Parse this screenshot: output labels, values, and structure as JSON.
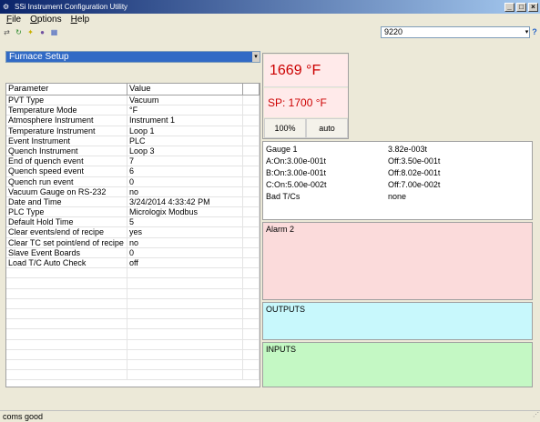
{
  "window": {
    "title": "SSi Instrument Configuration Utility",
    "minimize": "_",
    "maximize": "□",
    "close": "×"
  },
  "menu": [
    "File",
    "Options",
    "Help"
  ],
  "toolbar": {
    "address_value": "9220",
    "dropdown_arrow": "▾",
    "help_symbol": "?"
  },
  "section": {
    "selected": "Furnace Setup",
    "arrow": "▾"
  },
  "grid": {
    "headers": [
      "Parameter",
      "Value"
    ],
    "rows": [
      [
        "PVT Type",
        "Vacuum"
      ],
      [
        "Temperature Mode",
        "°F"
      ],
      [
        "Atmosphere Instrument",
        "Instrument 1"
      ],
      [
        "Temperature Instrument",
        "Loop 1"
      ],
      [
        "Event Instrument",
        "PLC"
      ],
      [
        "Quench Instrument",
        "Loop 3"
      ],
      [
        "End of quench event",
        "7"
      ],
      [
        "Quench speed event",
        "6"
      ],
      [
        "Quench run event",
        "0"
      ],
      [
        "Vacuum Gauge on RS-232",
        "no"
      ],
      [
        "Date and Time",
        "3/24/2014 4:33:42 PM"
      ],
      [
        "PLC Type",
        "Micrologix Modbus"
      ],
      [
        "Default Hold Time",
        "5"
      ],
      [
        "Clear events/end of recipe",
        "yes"
      ],
      [
        "Clear TC set point/end of recipe",
        "no"
      ],
      [
        "Slave Event Boards",
        "0"
      ],
      [
        "Load T/C Auto Check",
        "off"
      ]
    ]
  },
  "process": {
    "pv": "1669 °F",
    "sp": "SP: 1700 °F",
    "output_pct": "100%",
    "mode": "auto"
  },
  "gauge": {
    "rows": [
      [
        "Gauge 1",
        "3.82e-003t"
      ],
      [
        "A:On:3.00e-001t",
        "Off:3.50e-001t"
      ],
      [
        "B:On:3.00e-001t",
        "Off:8.02e-001t"
      ],
      [
        "C:On:5.00e-002t",
        "Off:7.00e-002t"
      ],
      [
        "Bad T/Cs",
        "none"
      ]
    ]
  },
  "panels": {
    "alarm": "Alarm 2",
    "outputs": "OUTPUTS",
    "inputs": "INPUTS"
  },
  "status": "coms good",
  "colors": {
    "pv_text": "#cc0000",
    "alarm_bg": "#fbdbdb",
    "outputs_bg": "#c8f8fc",
    "inputs_bg": "#c4f8c4",
    "selection": "#316ac5"
  }
}
